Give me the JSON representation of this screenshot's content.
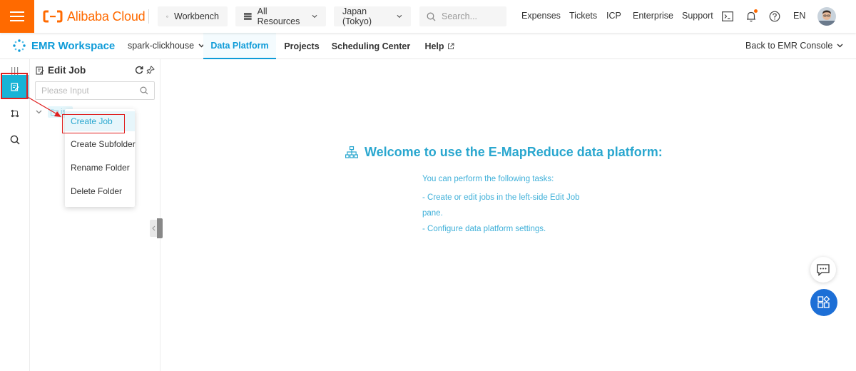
{
  "topbar": {
    "brand": "Alibaba Cloud",
    "workbench_label": "Workbench",
    "resources_label": "All Resources",
    "region_label": "Japan (Tokyo)",
    "search_placeholder": "Search...",
    "links": [
      "Expenses",
      "Tickets",
      "ICP",
      "Enterprise",
      "Support"
    ],
    "language": "EN",
    "brand_color": "#ff6a00"
  },
  "subnav": {
    "workspace_title": "EMR Workspace",
    "cluster": "spark-clickhouse",
    "tabs": [
      {
        "label": "Data Platform",
        "active": true
      },
      {
        "label": "Projects",
        "active": false
      },
      {
        "label": "Scheduling Center",
        "active": false
      },
      {
        "label": "Help",
        "active": false
      }
    ],
    "back_label": "Back to EMR Console",
    "accent_color": "#0e9bd8"
  },
  "rail": {
    "items": [
      "collapse-icon",
      "edit-job-icon",
      "workflow-icon",
      "search-icon"
    ],
    "active_index": 1
  },
  "panel": {
    "title": "Edit Job",
    "search_placeholder": "Please Input",
    "folder_name": "iss"
  },
  "context_menu": {
    "items": [
      "Create Job",
      "Create Subfolder",
      "Rename Folder",
      "Delete Folder"
    ],
    "hover_index": 0
  },
  "welcome": {
    "title": "Welcome to use the E-MapReduce data platform:",
    "lines": [
      "You can perform the following tasks:",
      "- Create or edit jobs in the left-side Edit Job",
      "pane.",
      "- Configure data platform settings."
    ],
    "color": "#2aa7cf"
  },
  "annotation_color": "#e02020"
}
